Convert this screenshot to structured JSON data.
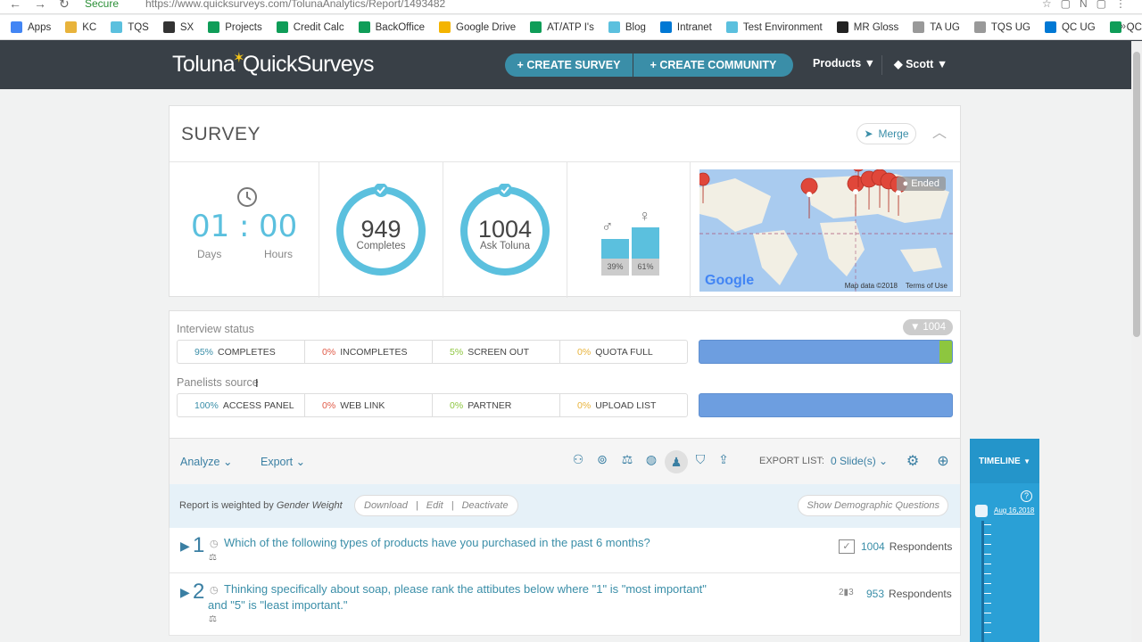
{
  "browser": {
    "secure_label": "Secure",
    "url": "https://www.quicksurveys.com/TolunaAnalytics/Report/1493482",
    "bookmarks": [
      {
        "label": "Apps",
        "icon": "apps-grid-icon",
        "color": "#4285f4"
      },
      {
        "label": "KC",
        "icon": "kc-icon",
        "color": "#e8b33b"
      },
      {
        "label": "TQS",
        "icon": "tqs-icon",
        "color": "#5bc0de"
      },
      {
        "label": "SX",
        "icon": "sx-icon",
        "color": "#333333"
      },
      {
        "label": "Projects",
        "icon": "sheets-icon",
        "color": "#0f9d58"
      },
      {
        "label": "Credit Calc",
        "icon": "sheets-icon",
        "color": "#0f9d58"
      },
      {
        "label": "BackOffice",
        "icon": "sheets-icon",
        "color": "#0f9d58"
      },
      {
        "label": "Google Drive",
        "icon": "drive-icon",
        "color": "#f4b400"
      },
      {
        "label": "AT/ATP I's",
        "icon": "sheets-icon",
        "color": "#0f9d58"
      },
      {
        "label": "Blog",
        "icon": "blog-icon",
        "color": "#5bc0de"
      },
      {
        "label": "Intranet",
        "icon": "sharepoint-icon",
        "color": "#0078d4"
      },
      {
        "label": "Test Environment",
        "icon": "tqs-icon",
        "color": "#5bc0de"
      },
      {
        "label": "MR Gloss",
        "icon": "gloss-icon",
        "color": "#222222"
      },
      {
        "label": "TA UG",
        "icon": "page-icon",
        "color": "#999999"
      },
      {
        "label": "TQS UG",
        "icon": "page-icon",
        "color": "#999999"
      },
      {
        "label": "QC UG",
        "icon": "sharepoint-icon",
        "color": "#0078d4"
      },
      {
        "label": "QC Tracker",
        "icon": "sheets-icon",
        "color": "#0f9d58"
      }
    ],
    "more": "»"
  },
  "header": {
    "logo_left": "Toluna",
    "logo_right": "QuickSurveys",
    "create_survey": "+ CREATE SURVEY",
    "create_community": "+ CREATE COMMUNITY",
    "products": "Products ▼",
    "user": "Scott ▼",
    "bg": "#394047",
    "accent": "#3a8ea8"
  },
  "survey": {
    "title": "SURVEY",
    "merge_label": "Merge",
    "days": "01",
    "hours": "00",
    "days_label": "Days",
    "hours_label": "Hours",
    "completes": {
      "value": "949",
      "label": "Completes"
    },
    "ask_toluna": {
      "value": "1004",
      "label": "Ask Toluna"
    },
    "gender": {
      "male_pct": "39%",
      "female_pct": "61%"
    },
    "map": {
      "ended_label": "Ended",
      "google": "Google",
      "map_data": "Map data ©2018",
      "terms": "Terms of Use"
    }
  },
  "interview": {
    "status_label": "Interview status",
    "badge_count": "1004",
    "status_segments": [
      {
        "pct": "95%",
        "label": "COMPLETES",
        "color": "#3a8ea8"
      },
      {
        "pct": "0%",
        "label": "INCOMPLETES",
        "color": "#e05a47"
      },
      {
        "pct": "5%",
        "label": "SCREEN OUT",
        "color": "#8dc63f"
      },
      {
        "pct": "0%",
        "label": "QUOTA FULL",
        "color": "#e8b33b"
      }
    ],
    "status_fill_pct": 95,
    "source_label": "Panelists source",
    "source_segments": [
      {
        "pct": "100%",
        "label": "ACCESS PANEL",
        "color": "#3a8ea8"
      },
      {
        "pct": "0%",
        "label": "WEB LINK",
        "color": "#e05a47"
      },
      {
        "pct": "0%",
        "label": "PARTNER",
        "color": "#8dc63f"
      },
      {
        "pct": "0%",
        "label": "UPLOAD LIST",
        "color": "#e8b33b"
      }
    ]
  },
  "toolbar": {
    "analyze": "Analyze",
    "export": "Export",
    "export_list_label": "EXPORT LIST:",
    "export_list_value": "0 Slide(s)"
  },
  "weighted": {
    "prefix": "Report is weighted by",
    "weight_name": "Gender Weight",
    "download": "Download",
    "edit": "Edit",
    "deactivate": "Deactivate",
    "show_demo": "Show Demographic Questions"
  },
  "questions": [
    {
      "num": "1",
      "text": "Which of the following types of products have you purchased in the past 6 months?",
      "count": "1004",
      "resp_label": "Respondents"
    },
    {
      "num": "2",
      "text": "Thinking specifically about soap, please rank the attibutes below where \"1\" is \"most important\" and \"5\" is \"least important.\"",
      "count": "953",
      "resp_label": "Respondents"
    }
  ],
  "timeline": {
    "label": "TIMELINE",
    "date": "Aug 16,2018"
  }
}
